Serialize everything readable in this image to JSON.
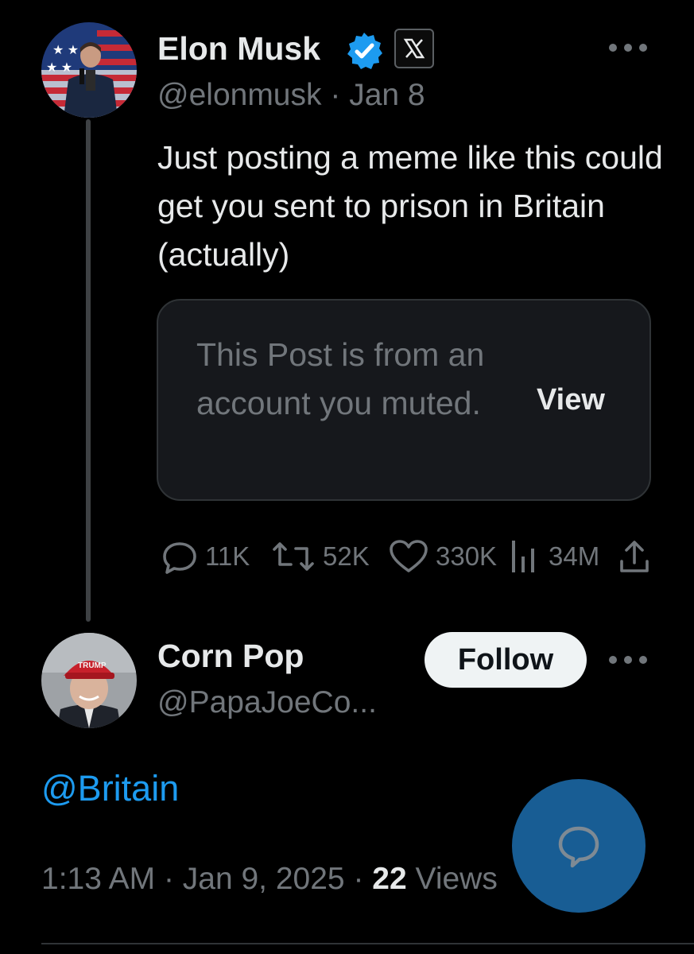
{
  "original_tweet": {
    "author_name": "Elon Musk",
    "handle": "@elonmusk",
    "separator": "·",
    "date": "Jan 8",
    "text": "Just posting a meme like this could get you sent to prison in Britain (actually)",
    "badges": [
      "verified-badge-icon",
      "x-affiliate-icon"
    ],
    "muted_notice": {
      "text": "This Post is from an account you muted.",
      "view_label": "View"
    },
    "actions": {
      "replies": "11K",
      "reposts": "52K",
      "likes": "330K",
      "views": "34M"
    }
  },
  "reply_tweet": {
    "author_name": "Corn Pop",
    "handle": "@PapaJoeCo...",
    "follow_label": "Follow",
    "text": "@Britain",
    "time": "1:13 AM",
    "date": "Jan 9, 2025",
    "view_count": "22",
    "views_label": "Views"
  },
  "colors": {
    "background": "#000000",
    "primary_text": "#e7e9ea",
    "secondary_text": "#71767b",
    "link": "#1d9bf0",
    "verified": "#1d9bf0",
    "fab": "#1d72b5"
  }
}
